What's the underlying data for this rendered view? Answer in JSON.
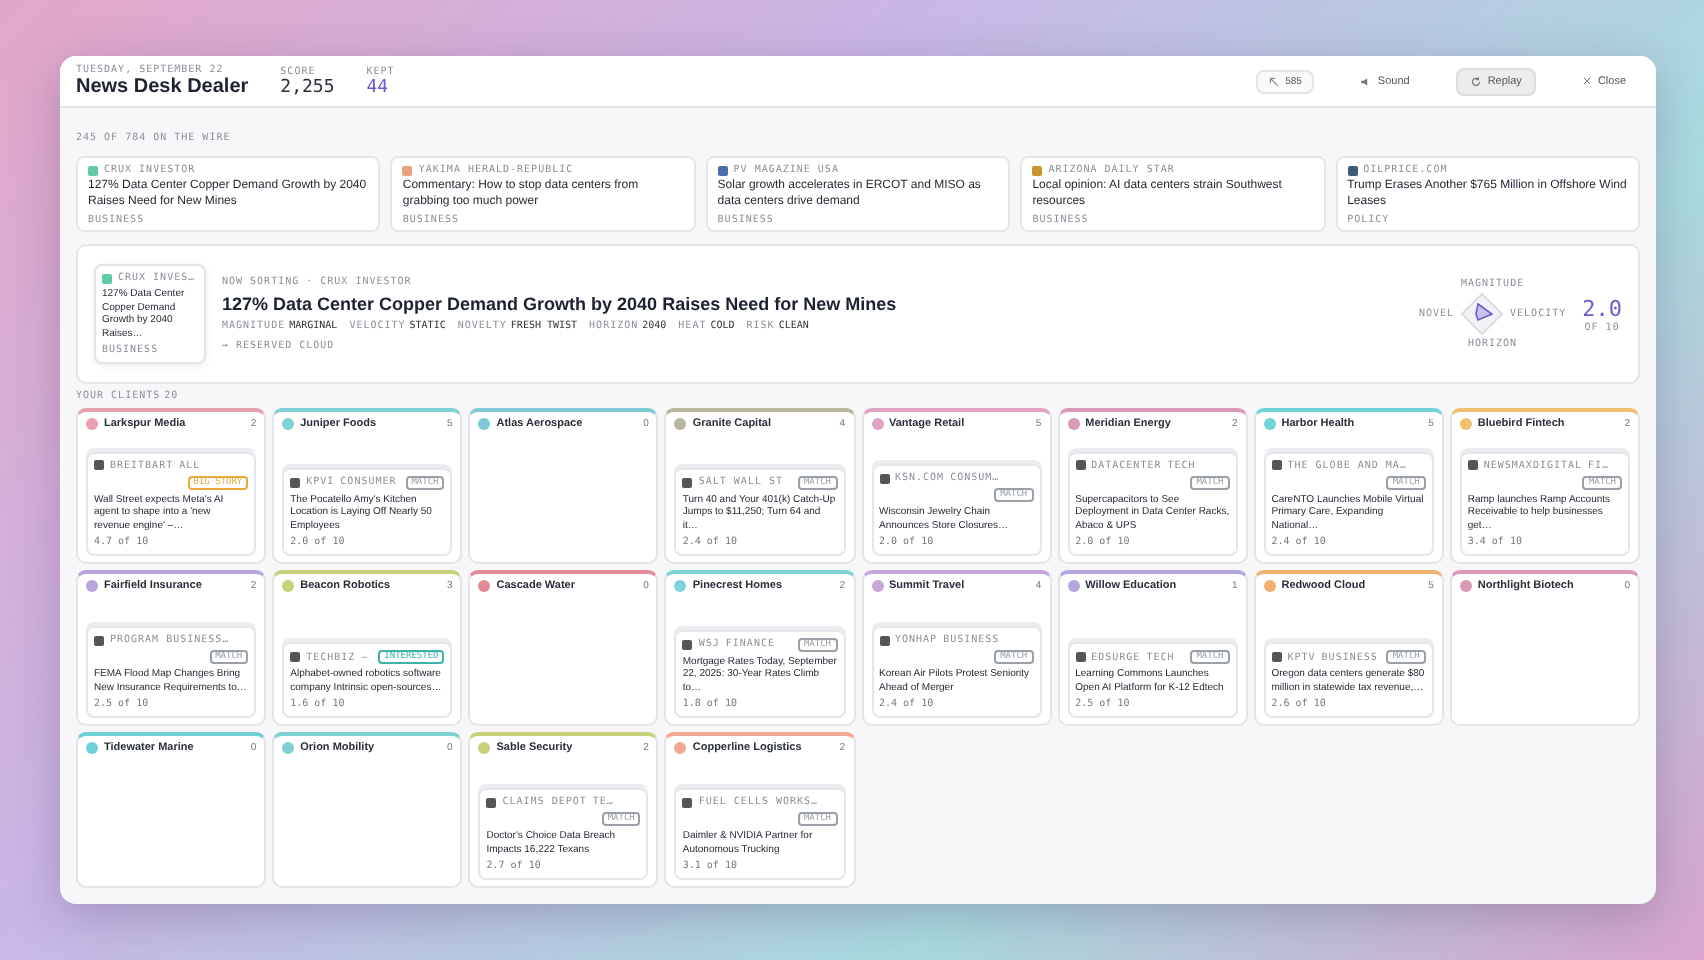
{
  "header": {
    "date": "TUESDAY, SEPTEMBER 22",
    "title": "News Desk Dealer",
    "stats": [
      {
        "label": "SCORE",
        "value": "2,255",
        "kind": "plain"
      },
      {
        "label": "KEPT",
        "value": "44",
        "kind": "accent"
      }
    ],
    "meter": "585",
    "buttons": [
      {
        "label": "Sound",
        "kind": "sound",
        "selected": false
      },
      {
        "label": "Replay",
        "kind": "replay",
        "selected": true
      },
      {
        "label": "Close",
        "kind": "close",
        "selected": false
      }
    ]
  },
  "wire": {
    "label": "245 OF 784 ON THE WIRE",
    "items": [
      {
        "source": "CRUX INVESTOR",
        "headline": "127% Data Center Copper Demand Growth by 2040 Raises Need for New Mines",
        "category": "BUSINESS",
        "color": "#5fc9a8"
      },
      {
        "source": "YAKIMA HERALD-REPUBLIC",
        "headline": "Commentary: How to stop data centers from grabbing too much power",
        "category": "BUSINESS",
        "color": "#e8a27a"
      },
      {
        "source": "PV MAGAZINE USA",
        "headline": "Solar growth accelerates in ERCOT and MISO as data centers drive demand",
        "category": "BUSINESS",
        "color": "#4a6fa8"
      },
      {
        "source": "ARIZONA DAILY STAR",
        "headline": "Local opinion: AI data centers strain Southwest resources",
        "category": "BUSINESS",
        "color": "#c9962e"
      },
      {
        "source": "OILPRICE.COM",
        "headline": "Trump Erases Another $765 Million in Offshore Wind Leases",
        "category": "POLICY",
        "color": "#3b5b7a"
      }
    ]
  },
  "current": {
    "thumb": {
      "source": "CRUX INVES…",
      "headline": "127% Data Center Copper Demand Growth by 2040 Raises…",
      "category": "BUSINESS"
    },
    "eyebrow": "NOW SORTING · CRUX INVESTOR",
    "title": "127% Data Center Copper Demand Growth by 2040 Raises Need for New Mines",
    "attributes": [
      {
        "label": "MAGNITUDE",
        "value": "MARGINAL"
      },
      {
        "label": "VELOCITY",
        "value": "STATIC"
      },
      {
        "label": "NOVELTY",
        "value": "FRESH TWIST"
      },
      {
        "label": "HORIZON",
        "value": "2040"
      },
      {
        "label": "HEAT",
        "value": "COLD"
      },
      {
        "label": "RISK",
        "value": "CLEAN"
      }
    ],
    "link": "→ RESERVED CLOUD",
    "radar": {
      "top": "MAGNITUDE",
      "left": "NOVEL",
      "right": "VELOCITY",
      "bottom": "HORIZON"
    },
    "score": "2.0",
    "score_of": "OF 10"
  },
  "clients": {
    "label": "YOUR CLIENTS",
    "count": "20",
    "items": [
      {
        "name": "Larkspur Media",
        "count": "2",
        "color": "#e6a0b0",
        "story": {
          "source": "BREITBART",
          "category": "ALL",
          "tag": {
            "label": "BIG STORY",
            "color": "#e9a93a"
          },
          "headline": "Wall Street expects Meta's AI agent to shape into a 'new revenue engine' –…",
          "score": "4.7 of 10"
        }
      },
      {
        "name": "Juniper Foods",
        "count": "5",
        "color": "#7fd1d6",
        "story": {
          "source": "KPVI",
          "category": "CONSUMER",
          "tag": {
            "label": "MATCH",
            "color": "#9aa0a8"
          },
          "headline": "The Pocatello Amy's Kitchen Location is Laying Off Nearly 50 Employees",
          "score": "2.0 of 10"
        }
      },
      {
        "name": "Atlas Aerospace",
        "count": "0",
        "color": "#7fc9d6"
      },
      {
        "name": "Granite Capital",
        "count": "4",
        "color": "#b7b59a",
        "story": {
          "source": "SALT WALL ST",
          "tag": {
            "label": "MATCH",
            "color": "#9aa0a8"
          },
          "headline": "Turn 40 and Your 401(k) Catch-Up Jumps to $11,250; Turn 64 and it…",
          "score": "2.4 of 10"
        }
      },
      {
        "name": "Vantage Retail",
        "count": "5",
        "color": "#e2a2c6",
        "story": {
          "source": "KSN.COM",
          "category": "CONSUM…",
          "tag": {
            "label": "MATCH",
            "color": "#9aa0a8"
          },
          "headline": "Wisconsin Jewelry Chain Announces Store Closures…",
          "score": "2.0 of 10"
        }
      },
      {
        "name": "Meridian Energy",
        "count": "2",
        "color": "#d99ab8",
        "story": {
          "source": "DATACENTER",
          "category": "TECH",
          "tag": {
            "label": "MATCH",
            "color": "#9aa0a8"
          },
          "headline": "Supercapacitors to See Deployment in Data Center Racks, Abaco & UPS",
          "score": "2.0 of 10"
        }
      },
      {
        "name": "Harbor Health",
        "count": "5",
        "color": "#6fd3d8",
        "story": {
          "source": "THE GLOBE AND MA…",
          "tag": {
            "label": "MATCH",
            "color": "#9aa0a8"
          },
          "headline": "CareNTO Launches Mobile Virtual Primary Care, Expanding National…",
          "score": "2.4 of 10"
        }
      },
      {
        "name": "Bluebird Fintech",
        "count": "2",
        "color": "#f0c070",
        "story": {
          "source": "NEWSMAXDIGITAL",
          "category": "FI…",
          "tag": {
            "label": "MATCH",
            "color": "#9aa0a8"
          },
          "headline": "Ramp launches Ramp Accounts Receivable to help businesses get…",
          "score": "3.4 of 10"
        }
      },
      {
        "name": "Fairfield Insurance",
        "count": "2",
        "color": "#b9a4dc",
        "story": {
          "source": "PROGRAM BUSINESS…",
          "tag": {
            "label": "MATCH",
            "color": "#9aa0a8"
          },
          "headline": "FEMA Flood Map Changes Bring New Insurance Requirements to…",
          "score": "2.5 of 10"
        }
      },
      {
        "name": "Beacon Robotics",
        "count": "3",
        "color": "#c8d17a",
        "story": {
          "source": "TECHBIZ",
          "category": "—",
          "tag": {
            "label": "INTERESTED",
            "color": "#3fb3a8"
          },
          "headline": "Alphabet-owned robotics software company Intrinsic open-sources…",
          "score": "1.6 of 10"
        }
      },
      {
        "name": "Cascade Water",
        "count": "0",
        "color": "#e28a95"
      },
      {
        "name": "Pinecrest Homes",
        "count": "2",
        "color": "#7fd3d8",
        "story": {
          "source": "WSJ",
          "category": "FINANCE",
          "tag": {
            "label": "MATCH",
            "color": "#9aa0a8"
          },
          "headline": "Mortgage Rates Today, September 22, 2025: 30-Year Rates Climb to…",
          "score": "1.8 of 10"
        }
      },
      {
        "name": "Summit Travel",
        "count": "4",
        "color": "#c7a6dc",
        "story": {
          "source": "YONHAP",
          "category": "BUSINESS",
          "tag": {
            "label": "MATCH",
            "color": "#9aa0a8"
          },
          "headline": "Korean Air Pilots Protest Seniority Ahead of Merger",
          "score": "2.4 of 10"
        }
      },
      {
        "name": "Willow Education",
        "count": "1",
        "color": "#b6a6e0",
        "story": {
          "source": "EDSURGE",
          "category": "TECH",
          "tag": {
            "label": "MATCH",
            "color": "#9aa0a8"
          },
          "headline": "Learning Commons Launches Open AI Platform for K-12 Edtech",
          "score": "2.5 of 10"
        }
      },
      {
        "name": "Redwood Cloud",
        "count": "5",
        "color": "#f2b070",
        "story": {
          "source": "KPTV",
          "category": "BUSINESS",
          "tag": {
            "label": "MATCH",
            "color": "#9aa0a8"
          },
          "headline": "Oregon data centers generate $80 million in statewide tax revenue,…",
          "score": "2.6 of 10"
        }
      },
      {
        "name": "Northlight Biotech",
        "count": "0",
        "color": "#d99ab8"
      },
      {
        "name": "Tidewater Marine",
        "count": "0",
        "color": "#6fcfd8"
      },
      {
        "name": "Orion Mobility",
        "count": "0",
        "color": "#7fd0d0"
      },
      {
        "name": "Sable Security",
        "count": "2",
        "color": "#c9d07a",
        "story": {
          "source": "CLAIMS DEPOT",
          "category": "TE…",
          "tag": {
            "label": "MATCH",
            "color": "#9aa0a8"
          },
          "headline": "Doctor's Choice Data Breach Impacts 16,222 Texans",
          "score": "2.7 of 10"
        }
      },
      {
        "name": "Copperline Logistics",
        "count": "2",
        "color": "#f0a890",
        "story": {
          "source": "FUEL CELLS WORKS…",
          "tag": {
            "label": "MATCH",
            "color": "#9aa0a8"
          },
          "headline": "Daimler & NVIDIA Partner for Autonomous Trucking",
          "score": "3.1 of 10"
        }
      }
    ]
  }
}
